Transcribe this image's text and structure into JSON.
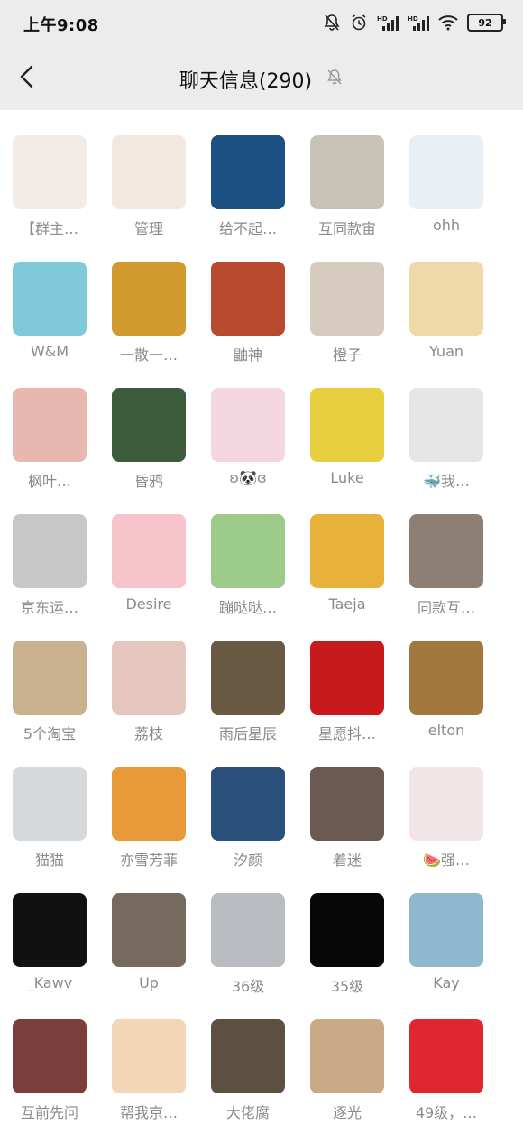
{
  "status_bar": {
    "time": "上午9:08",
    "battery": "92"
  },
  "header": {
    "back_icon": "chevron-left-icon",
    "title": "聊天信息(290)",
    "mute_icon": "bell-off-icon"
  },
  "members": [
    {
      "name": "【群主…",
      "color": "#f3ece6"
    },
    {
      "name": "管理",
      "color": "#f1e8e2"
    },
    {
      "name": "给不起…",
      "color": "#1c4f82"
    },
    {
      "name": "互同款宙",
      "color": "#c7c3b7"
    },
    {
      "name": "ohh",
      "color": "#e9f0f5"
    },
    {
      "name": "W&M",
      "color": "#7fc9d8"
    },
    {
      "name": "一散一…",
      "color": "#d09a2c"
    },
    {
      "name": "鼬神",
      "color": "#b94a2f"
    },
    {
      "name": "橙子",
      "color": "#d7cbc0"
    },
    {
      "name": "Yuan",
      "color": "#f0d9a8"
    },
    {
      "name": "枫叶…",
      "color": "#e8b8b0"
    },
    {
      "name": "昏鸦",
      "color": "#3d5c3b"
    },
    {
      "name": "ʚ🐼ɞ",
      "color": "#f4d6e0"
    },
    {
      "name": "Luke",
      "color": "#e7cf40"
    },
    {
      "name": "🐳我…",
      "color": "#e6e6e6"
    },
    {
      "name": "京东运…",
      "color": "#c7c7c7"
    },
    {
      "name": "Desire",
      "color": "#f7c4cc"
    },
    {
      "name": "蹦哒哒…",
      "color": "#9ccb8a"
    },
    {
      "name": "Taeja",
      "color": "#e8b13a"
    },
    {
      "name": "同款互…",
      "color": "#8d7f74"
    },
    {
      "name": "5个淘宝",
      "color": "#c9b08e"
    },
    {
      "name": "荔枝",
      "color": "#e6c7bf"
    },
    {
      "name": "雨后星辰",
      "color": "#6b5a43"
    },
    {
      "name": "星愿抖…",
      "color": "#c8191c"
    },
    {
      "name": "elton",
      "color": "#a2773e"
    },
    {
      "name": "猫猫",
      "color": "#d6d9dc"
    },
    {
      "name": "亦雪芳菲",
      "color": "#e89a3b"
    },
    {
      "name": "汐颜",
      "color": "#2a4f7a"
    },
    {
      "name": "着迷",
      "color": "#6a5a52"
    },
    {
      "name": "🍉强…",
      "color": "#f1e5e7"
    },
    {
      "name": "_Kawv",
      "color": "#111111"
    },
    {
      "name": "Up",
      "color": "#766a5e"
    },
    {
      "name": "36级",
      "color": "#b9bcc0"
    },
    {
      "name": "35级",
      "color": "#070707"
    },
    {
      "name": "Kay",
      "color": "#8fb7cf"
    },
    {
      "name": "互前先问",
      "color": "#7a3f3a"
    },
    {
      "name": "帮我京…",
      "color": "#f3d6b8"
    },
    {
      "name": "大佬腐",
      "color": "#5d5040"
    },
    {
      "name": "逐光",
      "color": "#caa986"
    },
    {
      "name": "49级，…",
      "color": "#e0262f"
    }
  ]
}
